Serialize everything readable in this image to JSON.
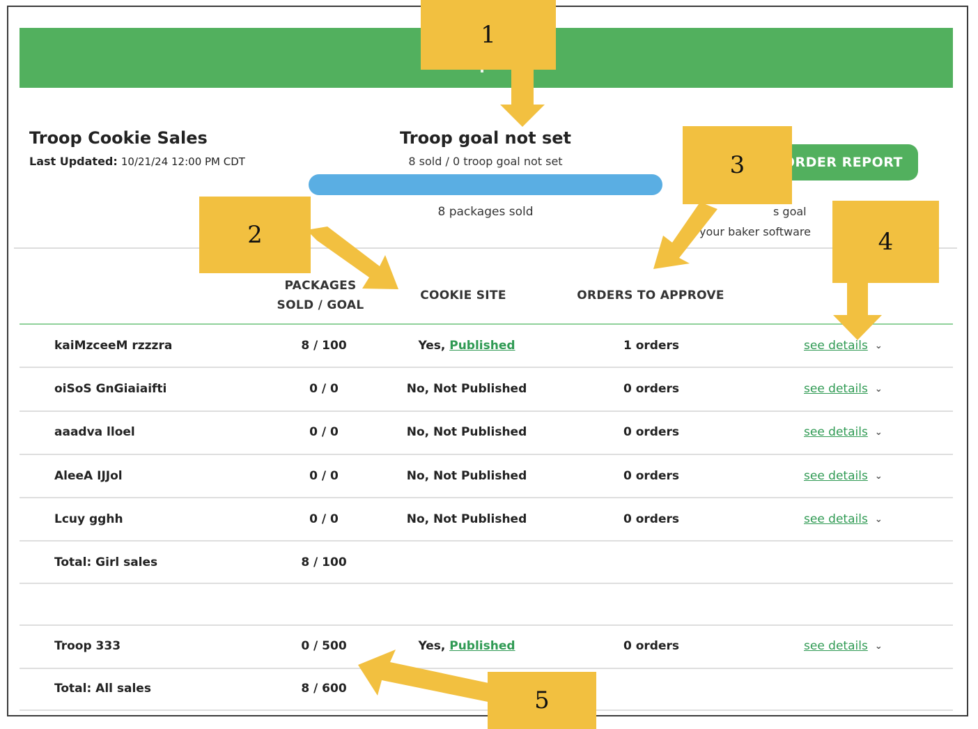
{
  "header": {
    "title": "Troop Cookie Sales",
    "last_updated_label": "Last Updated:",
    "last_updated_value": "10/21/24 12:00 PM CDT"
  },
  "goal": {
    "title": "Troop goal not set",
    "subtitle": "8 sold / 0 troop goal not set",
    "packages_sold": "8 packages sold",
    "progress_fraction": 1.0
  },
  "actions": {
    "order_report_label": "ORDER REPORT",
    "partial_text_1": "s goal",
    "partial_text_2": "your baker software"
  },
  "table": {
    "headers": {
      "packages_line1": "PACKAGES",
      "packages_line2": "SOLD / GOAL",
      "cookie_site": "COOKIE SITE",
      "orders": "ORDERS TO APPROVE"
    },
    "rows": [
      {
        "name": "kaiMzceeM rzzzra",
        "packages": "8 / 100",
        "site_prefix": "Yes,",
        "site_link": "Published",
        "orders": "1 orders",
        "details": "see details"
      },
      {
        "name": "oiSoS GnGiaiaifti",
        "packages": "0 / 0",
        "site_prefix": "No, Not Published",
        "site_link": "",
        "orders": "0 orders",
        "details": "see details"
      },
      {
        "name": "aaadva lloel",
        "packages": "0 / 0",
        "site_prefix": "No, Not Published",
        "site_link": "",
        "orders": "0 orders",
        "details": "see details"
      },
      {
        "name": "AleeA IJJol",
        "packages": "0 / 0",
        "site_prefix": "No, Not Published",
        "site_link": "",
        "orders": "0 orders",
        "details": "see details"
      },
      {
        "name": "Lcuy gghh",
        "packages": "0 / 0",
        "site_prefix": "No, Not Published",
        "site_link": "",
        "orders": "0 orders",
        "details": "see details"
      }
    ],
    "total_girl": {
      "label": "Total: Girl sales",
      "packages": "8 / 100"
    },
    "troop_row": {
      "name": "Troop 333",
      "packages": "0 / 500",
      "site_prefix": "Yes,",
      "site_link": "Published",
      "orders": "0 orders",
      "details": "see details"
    },
    "total_all": {
      "label": "Total: All sales",
      "packages": "8 / 600"
    }
  },
  "callouts": [
    "1",
    "2",
    "3",
    "4",
    "5"
  ],
  "colors": {
    "brand_green": "#52b05e",
    "progress_blue": "#5aaee3",
    "callout_yellow": "#f2c040",
    "link_green": "#2f9a53"
  }
}
